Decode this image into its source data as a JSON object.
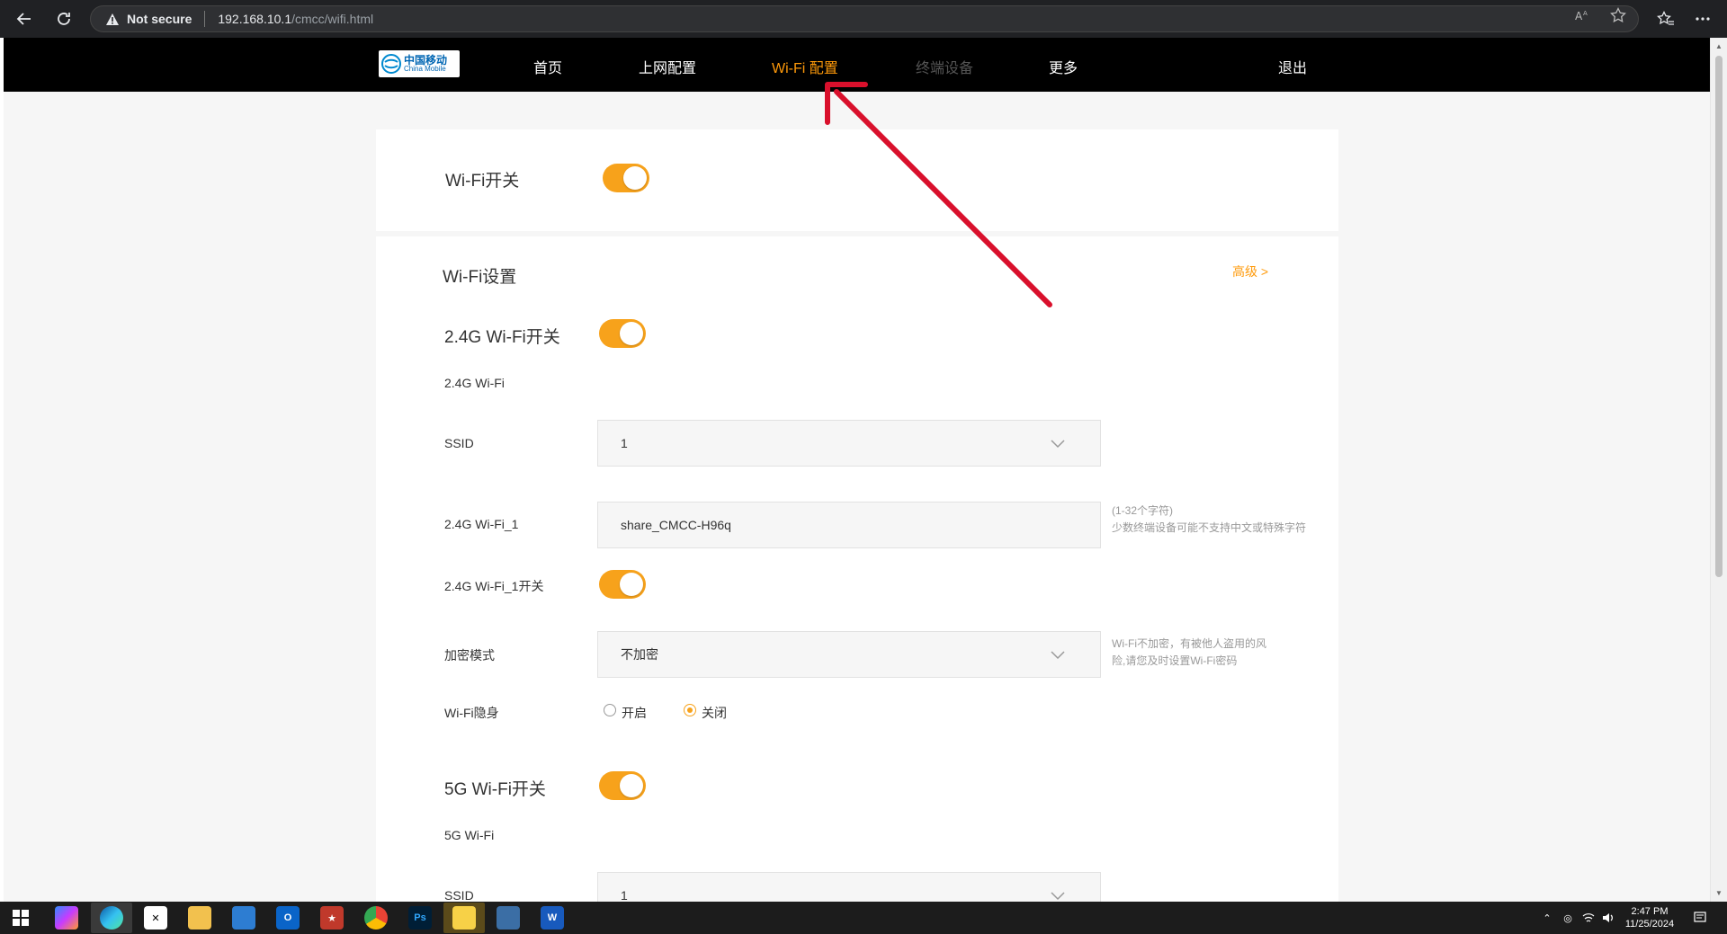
{
  "browser": {
    "security_label": "Not secure",
    "url_host": "192.168.10.1",
    "url_path": "/cmcc/wifi.html"
  },
  "header": {
    "logo_cn": "中国移动",
    "logo_en": "China Mobile",
    "nav": [
      {
        "label": "首页",
        "state": "normal"
      },
      {
        "label": "上网配置",
        "state": "normal"
      },
      {
        "label": "Wi-Fi 配置",
        "state": "active"
      },
      {
        "label": "终端设备",
        "state": "disabled"
      },
      {
        "label": "更多",
        "state": "normal"
      }
    ],
    "logout": "退出"
  },
  "wifi_master": {
    "label": "Wi-Fi开关",
    "enabled": true
  },
  "wifi_settings": {
    "title": "Wi-Fi设置",
    "advanced": "高级 >",
    "band24": {
      "switch_label": "2.4G Wi-Fi开关",
      "switch_on": true,
      "section_label": "2.4G Wi-Fi",
      "ssid_label": "SSID",
      "ssid_value": "1",
      "name_label": "2.4G Wi-Fi_1",
      "name_value": "share_CMCC-H96q",
      "name_hint_1": "(1-32个字符)",
      "name_hint_2": "少数终端设备可能不支持中文或特殊字符",
      "sub_switch_label": "2.4G Wi-Fi_1开关",
      "sub_switch_on": true,
      "encryption_label": "加密模式",
      "encryption_value": "不加密",
      "encryption_hint_1": "Wi-Fi不加密，有被他人盗用的风",
      "encryption_hint_2": "险,请您及时设置Wi-Fi密码",
      "hidden_label": "Wi-Fi隐身",
      "hidden_on_label": "开启",
      "hidden_off_label": "关闭",
      "hidden_selected": "关闭"
    },
    "band5": {
      "switch_label": "5G Wi-Fi开关",
      "switch_on": true,
      "section_label": "5G Wi-Fi",
      "ssid_label": "SSID",
      "ssid_value": "1"
    }
  },
  "taskbar": {
    "time": "2:47 PM",
    "date": "11/25/2024"
  },
  "colors": {
    "accent": "#f7a21b",
    "nav_active": "#ff9a0a",
    "annotation_arrow": "#d9102c",
    "header_bg": "#000000"
  }
}
